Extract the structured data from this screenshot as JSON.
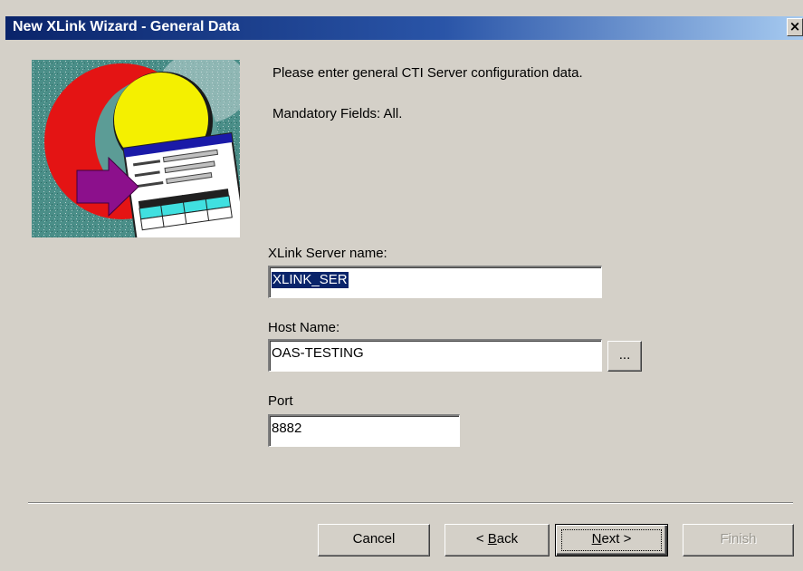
{
  "window": {
    "title": "New XLink Wizard - General Data",
    "close_glyph": "×",
    "colors": {
      "title_bar": "#0a246a",
      "dialog_bg": "#d4d0c8",
      "selection": "#0a246a"
    }
  },
  "image": {
    "icon": "wizard-illustration"
  },
  "instructions": {
    "line1": "Please enter general CTI Server configuration data.",
    "line2": "Mandatory Fields: All."
  },
  "fields": {
    "server_name": {
      "label": "XLink Server name:",
      "value": "XLINK_SER"
    },
    "host_name": {
      "label": "Host Name:",
      "value": "OAS-TESTING",
      "browse_label": "..."
    },
    "port": {
      "label": "Port",
      "value": "8882"
    }
  },
  "buttons": {
    "cancel": "Cancel",
    "back": {
      "prefix": "< ",
      "key": "B",
      "rest": "ack"
    },
    "next": {
      "key": "N",
      "rest": "ext >"
    },
    "finish": "Finish"
  }
}
